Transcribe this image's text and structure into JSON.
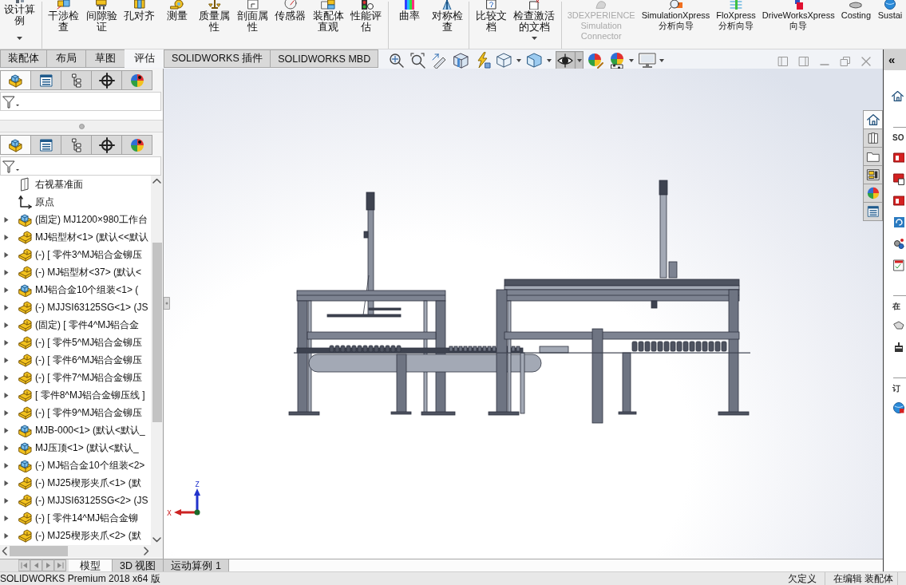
{
  "ribbon": {
    "groups": [
      {
        "buttons": [
          {
            "label": "设计算例",
            "dropdown": true,
            "disabled": false
          }
        ]
      },
      {
        "buttons": [
          {
            "label": "干涉检查",
            "dropdown": false,
            "disabled": false
          },
          {
            "label": "间隙验证",
            "dropdown": false,
            "disabled": false
          },
          {
            "label": "孔对齐",
            "dropdown": false,
            "disabled": false
          },
          {
            "label": "测量",
            "dropdown": false,
            "disabled": false
          },
          {
            "label": "质量属性",
            "dropdown": false,
            "disabled": false
          },
          {
            "label": "剖面属性",
            "dropdown": false,
            "disabled": false
          },
          {
            "label": "传感器",
            "dropdown": false,
            "disabled": false
          },
          {
            "label": "装配体直观",
            "dropdown": false,
            "disabled": false
          },
          {
            "label": "性能评估",
            "dropdown": false,
            "disabled": false
          }
        ]
      },
      {
        "buttons": [
          {
            "label": "曲率",
            "dropdown": false,
            "disabled": false
          },
          {
            "label": "对称检查",
            "dropdown": false,
            "disabled": false
          }
        ]
      },
      {
        "buttons": [
          {
            "label": "比较文档",
            "dropdown": false,
            "disabled": false
          },
          {
            "label": "检查激活的文档",
            "dropdown": true,
            "disabled": false
          }
        ]
      },
      {
        "buttons": [
          {
            "label": "3DEXPERIENCE Simulation Connector",
            "dropdown": false,
            "disabled": true
          },
          {
            "label": "SimulationXpress 分析向导",
            "dropdown": false,
            "disabled": false
          },
          {
            "label": "FloXpress 分析向导",
            "dropdown": false,
            "disabled": false
          },
          {
            "label": "DriveWorksXpress 向导",
            "dropdown": false,
            "disabled": false
          },
          {
            "label": "Costing",
            "dropdown": false,
            "disabled": false
          },
          {
            "label": "Sustai",
            "dropdown": false,
            "disabled": false
          }
        ]
      }
    ]
  },
  "command_tabs": [
    {
      "label": "装配体",
      "selected": false
    },
    {
      "label": "布局",
      "selected": false
    },
    {
      "label": "草图",
      "selected": false
    },
    {
      "label": "评估",
      "selected": true
    },
    {
      "label": "SOLIDWORKS 插件",
      "selected": false
    },
    {
      "label": "SOLIDWORKS MBD",
      "selected": false
    }
  ],
  "view_toolbar": [
    {
      "pressed": false,
      "dropdown": false
    },
    {
      "pressed": false,
      "dropdown": false
    },
    {
      "pressed": false,
      "dropdown": false
    },
    {
      "pressed": false,
      "dropdown": false
    },
    {
      "pressed": false,
      "dropdown": false
    },
    {
      "pressed": false,
      "dropdown": true
    },
    {
      "pressed": false,
      "dropdown": true
    },
    {
      "pressed": true,
      "dropdown": true
    },
    {
      "pressed": false,
      "dropdown": false
    },
    {
      "pressed": false,
      "dropdown": true
    },
    {
      "pressed": false,
      "dropdown": true
    }
  ],
  "feature_panes": [
    {
      "tabs": [
        {
          "selected": true
        },
        {
          "selected": false
        },
        {
          "selected": false
        },
        {
          "selected": false
        },
        {
          "selected": false
        }
      ]
    },
    {
      "tabs": [
        {
          "selected": true
        },
        {
          "selected": false
        },
        {
          "selected": false
        },
        {
          "selected": false
        },
        {
          "selected": false
        }
      ]
    }
  ],
  "feature_tree": {
    "items": [
      {
        "kind": "plane",
        "label": "右视基准面"
      },
      {
        "kind": "origin",
        "label": "原点"
      },
      {
        "kind": "assembly",
        "label": "(固定) MJ1200×980工作台",
        "expanded": false
      },
      {
        "kind": "part",
        "label": "MJ铝型材<1> (默认<<默认",
        "expanded": false
      },
      {
        "kind": "part",
        "label": "(-) [ 零件3^MJ铝合金铆压",
        "expanded": false
      },
      {
        "kind": "part",
        "label": "(-) MJ铝型材<37> (默认<",
        "expanded": false
      },
      {
        "kind": "assembly",
        "label": "MJ铝合金10个组装<1> (",
        "expanded": false
      },
      {
        "kind": "part",
        "label": "(-) MJJSI63125SG<1> (JS",
        "expanded": false
      },
      {
        "kind": "part",
        "label": "(固定) [ 零件4^MJ铝合金",
        "expanded": false
      },
      {
        "kind": "part",
        "label": "(-) [ 零件5^MJ铝合金铆压",
        "expanded": false
      },
      {
        "kind": "part",
        "label": "(-) [ 零件6^MJ铝合金铆压",
        "expanded": false
      },
      {
        "kind": "part",
        "label": "(-) [ 零件7^MJ铝合金铆压",
        "expanded": false
      },
      {
        "kind": "part",
        "label": "[ 零件8^MJ铝合金铆压线 ]",
        "expanded": false
      },
      {
        "kind": "part",
        "label": "(-) [ 零件9^MJ铝合金铆压",
        "expanded": false
      },
      {
        "kind": "assembly",
        "label": "MJB-000<1> (默认<默认_",
        "expanded": false
      },
      {
        "kind": "assembly",
        "label": "MJ压顶<1> (默认<默认_",
        "expanded": false
      },
      {
        "kind": "assembly",
        "label": "(-) MJ铝合金10个组装<2>",
        "expanded": false
      },
      {
        "kind": "part",
        "label": "(-) MJ25楔形夹爪<1> (默",
        "expanded": false
      },
      {
        "kind": "part",
        "label": "(-) MJJSI63125SG<2> (JS",
        "expanded": false
      },
      {
        "kind": "part",
        "label": "(-) [ 零件14^MJ铝合金铆",
        "expanded": false
      },
      {
        "kind": "part",
        "label": "(-) MJ25楔形夹爪<2> (默",
        "expanded": false
      }
    ]
  },
  "model_tabs": [
    {
      "label": "模型",
      "selected": true
    },
    {
      "label": "3D 视图",
      "selected": false
    },
    {
      "label": "运动算例 1",
      "selected": false
    }
  ],
  "viewport": {
    "triad": {
      "z_label": "Z",
      "x_label": "X"
    }
  },
  "task_pane": {
    "collapse_label": "«",
    "tabs": [
      {
        "selected": true
      },
      {
        "selected": false
      },
      {
        "selected": false
      },
      {
        "selected": false
      },
      {
        "selected": false
      },
      {
        "selected": false
      }
    ],
    "sections": [
      {
        "title": "SO"
      },
      {
        "title": "在"
      },
      {
        "title": "订"
      }
    ]
  },
  "status_bar": {
    "product": "SOLIDWORKS Premium 2018 x64 版",
    "state": "欠定义",
    "mode": "在编辑 装配体"
  }
}
